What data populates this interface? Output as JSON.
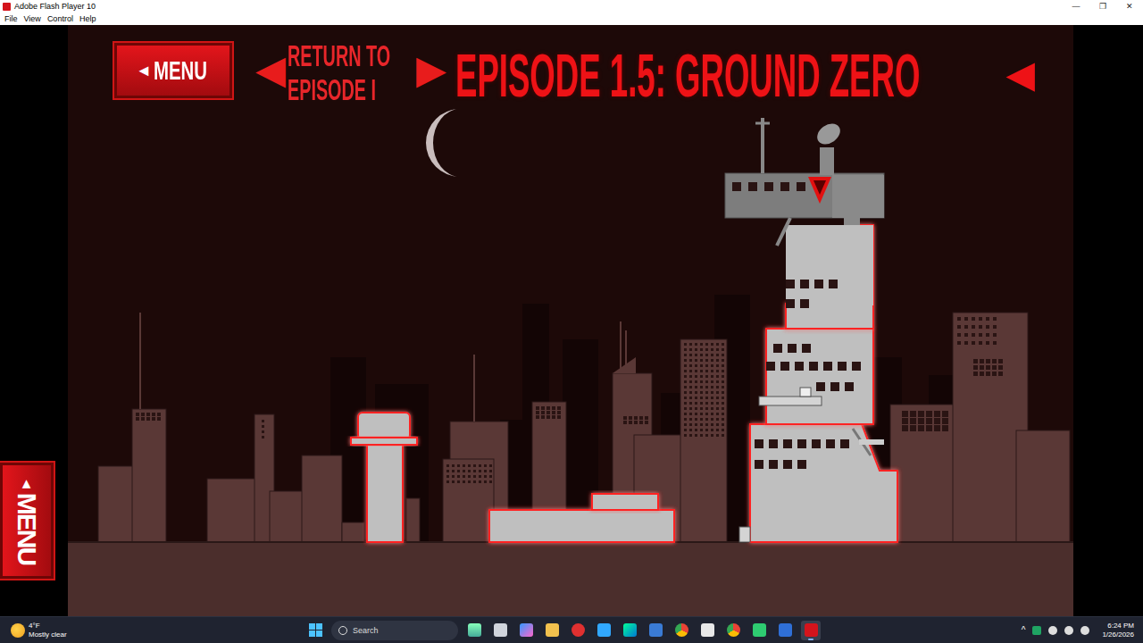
{
  "window": {
    "title": "Adobe Flash Player 10",
    "controls": [
      "—",
      "❐",
      "✕"
    ]
  },
  "menu_bar": [
    "File",
    "View",
    "Control",
    "Help"
  ],
  "game": {
    "menu_button": {
      "arrow": "◄",
      "label": "MENU"
    },
    "return_button": {
      "left_arrow": "◀",
      "lines": [
        "RETURN TO",
        "EPISODE I"
      ],
      "right_arrow": "▶"
    },
    "episode": {
      "title": "EPISODE 1.5: GROUND ZERO",
      "arrow": "◄"
    },
    "side_menu": {
      "arrow": "◄",
      "label": "MENU"
    }
  },
  "taskbar": {
    "weather": {
      "temp": "4°F",
      "condition": "Mostly clear"
    },
    "search": {
      "placeholder": "Search"
    },
    "apps": [
      {
        "kind": "widgets",
        "active": false
      },
      {
        "kind": "taskview",
        "active": false
      },
      {
        "kind": "copilot",
        "active": false
      },
      {
        "kind": "explorer",
        "active": false
      },
      {
        "kind": "record",
        "active": false
      },
      {
        "kind": "ps",
        "active": false
      },
      {
        "kind": "edge",
        "active": false
      },
      {
        "kind": "store",
        "active": false
      },
      {
        "kind": "chrome",
        "active": false
      },
      {
        "kind": "notepad",
        "active": false
      },
      {
        "kind": "chrome2",
        "active": false
      },
      {
        "kind": "pt",
        "active": false
      },
      {
        "kind": "defender",
        "active": false
      },
      {
        "kind": "flash",
        "active": true
      }
    ],
    "tray": {
      "chevron": "^"
    },
    "clock": {
      "time": "6:24 PM",
      "date": "1/26/2026"
    }
  }
}
